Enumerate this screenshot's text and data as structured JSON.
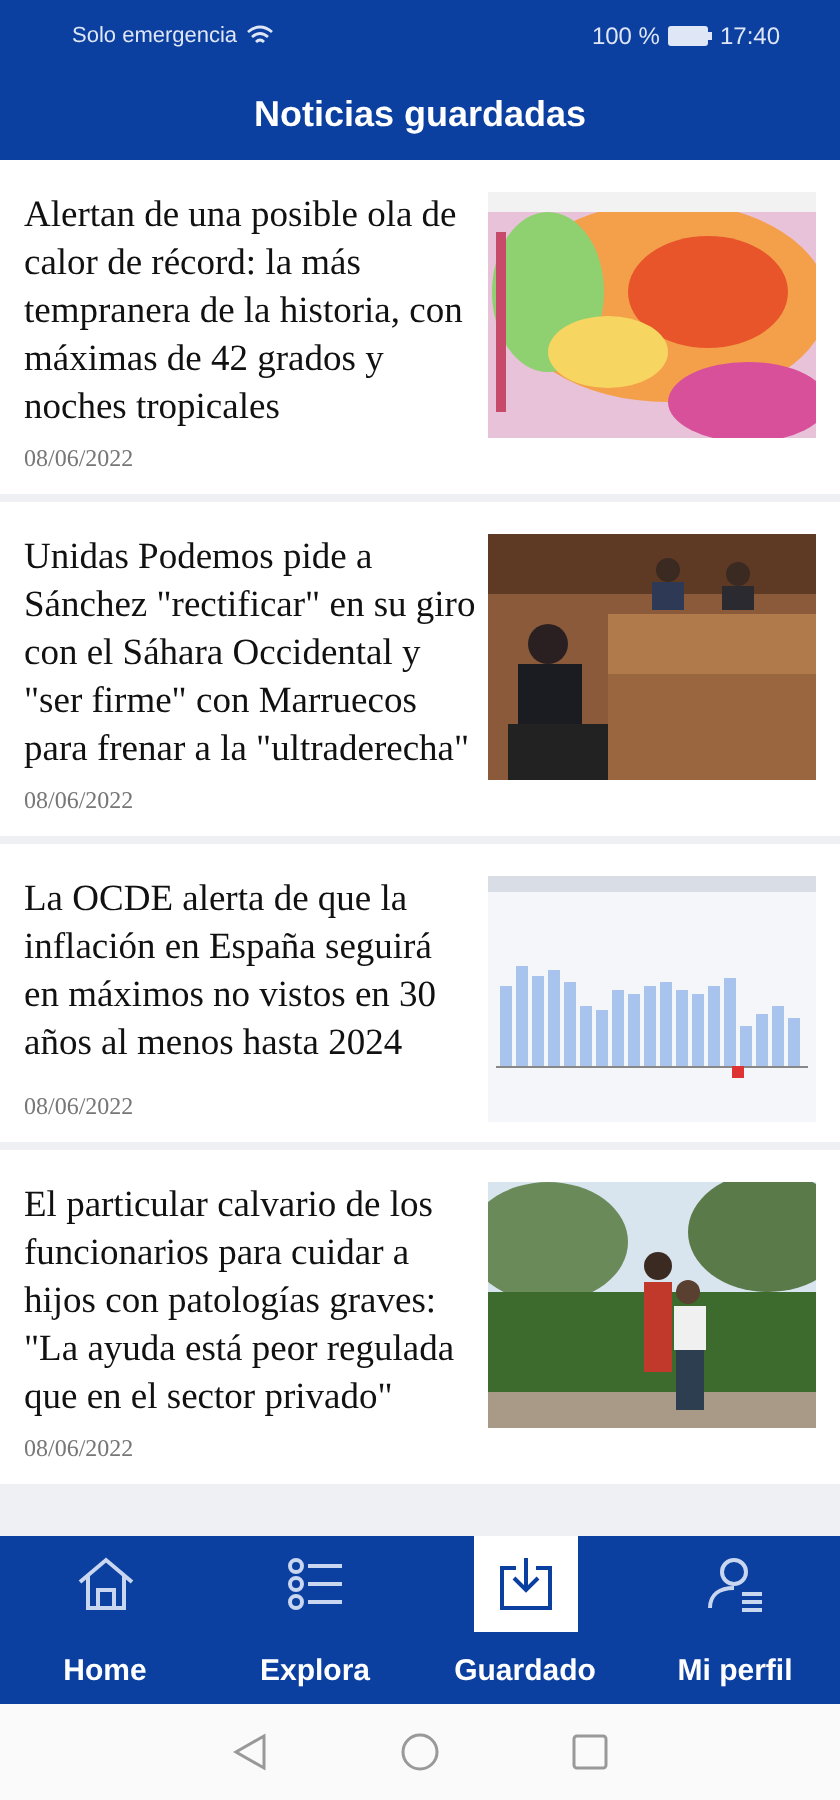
{
  "status_bar": {
    "carrier": "Solo emergencia",
    "battery": "100 %",
    "time": "17:40"
  },
  "header": {
    "title": "Noticias guardadas"
  },
  "articles": [
    {
      "title": "Alertan de una posible ola de calor de récord: la más tempranera de la historia, con máximas de 42 grados y noches tropicales",
      "date": "08/06/2022"
    },
    {
      "title": "Unidas Podemos pide a Sánchez \"rectificar\" en su giro con el Sáhara Occidental y \"ser firme\" con Marruecos para frenar a la \"ultraderecha\"",
      "date": "08/06/2022"
    },
    {
      "title": "La OCDE alerta de que la inflación en España seguirá en máximos no vistos en 30 años al menos hasta 2024",
      "date": "08/06/2022"
    },
    {
      "title": "El particular calvario de los funcionarios para cuidar a hijos con patologías graves: \"La ayuda está peor regulada que en el sector privado\"",
      "date": "08/06/2022"
    }
  ],
  "nav": [
    {
      "label": "Home",
      "selected": false
    },
    {
      "label": "Explora",
      "selected": false
    },
    {
      "label": "Guardado",
      "selected": true
    },
    {
      "label": "Mi perfil",
      "selected": false
    }
  ]
}
